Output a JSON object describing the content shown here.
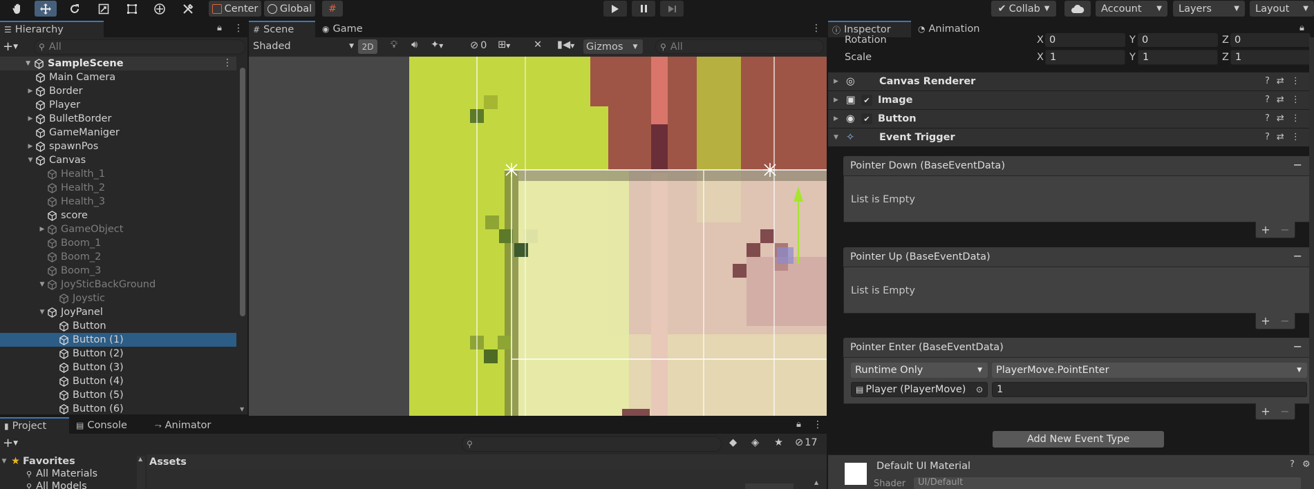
{
  "toolbar": {
    "center_label": "Center",
    "global_label": "Global",
    "collab_label": "Collab",
    "account_label": "Account",
    "layers_label": "Layers",
    "layout_label": "Layout"
  },
  "hierarchy": {
    "tab_label": "Hierarchy",
    "search_placeholder": "All",
    "scene_name": "SampleScene",
    "items": [
      {
        "label": "Main Camera",
        "depth": 1,
        "arrow": false,
        "dim": false
      },
      {
        "label": "Border",
        "depth": 1,
        "arrow": true,
        "dim": false
      },
      {
        "label": "Player",
        "depth": 1,
        "arrow": false,
        "dim": false
      },
      {
        "label": "BulletBorder",
        "depth": 1,
        "arrow": true,
        "dim": false
      },
      {
        "label": "GameManiger",
        "depth": 1,
        "arrow": false,
        "dim": false
      },
      {
        "label": "spawnPos",
        "depth": 1,
        "arrow": true,
        "dim": false
      },
      {
        "label": "Canvas",
        "depth": 1,
        "arrow": "open",
        "dim": false
      },
      {
        "label": "Health_1",
        "depth": 2,
        "arrow": false,
        "dim": true
      },
      {
        "label": "Health_2",
        "depth": 2,
        "arrow": false,
        "dim": true
      },
      {
        "label": "Health_3",
        "depth": 2,
        "arrow": false,
        "dim": true
      },
      {
        "label": "score",
        "depth": 2,
        "arrow": false,
        "dim": false
      },
      {
        "label": "GameObject",
        "depth": 2,
        "arrow": true,
        "dim": true
      },
      {
        "label": "Boom_1",
        "depth": 2,
        "arrow": false,
        "dim": true
      },
      {
        "label": "Boom_2",
        "depth": 2,
        "arrow": false,
        "dim": true
      },
      {
        "label": "Boom_3",
        "depth": 2,
        "arrow": false,
        "dim": true
      },
      {
        "label": "JoySticBackGround",
        "depth": 2,
        "arrow": "open",
        "dim": true
      },
      {
        "label": "Joystic",
        "depth": 3,
        "arrow": false,
        "dim": true
      },
      {
        "label": "JoyPanel",
        "depth": 2,
        "arrow": "open",
        "dim": false
      },
      {
        "label": "Button",
        "depth": 3,
        "arrow": false,
        "dim": false
      },
      {
        "label": "Button (1)",
        "depth": 3,
        "arrow": false,
        "dim": false,
        "selected": true
      },
      {
        "label": "Button (2)",
        "depth": 3,
        "arrow": false,
        "dim": false
      },
      {
        "label": "Button (3)",
        "depth": 3,
        "arrow": false,
        "dim": false
      },
      {
        "label": "Button (4)",
        "depth": 3,
        "arrow": false,
        "dim": false
      },
      {
        "label": "Button (5)",
        "depth": 3,
        "arrow": false,
        "dim": false
      },
      {
        "label": "Button (6)",
        "depth": 3,
        "arrow": false,
        "dim": false
      }
    ]
  },
  "scene": {
    "tab_scene": "Scene",
    "tab_game": "Game",
    "shading_mode": "Shaded",
    "mode_2d": "2D",
    "hidden_count": "0",
    "gizmos_label": "Gizmos",
    "search_placeholder": "All"
  },
  "project": {
    "tab_project": "Project",
    "tab_console": "Console",
    "tab_animator": "Animator",
    "favorites_label": "Favorites",
    "fav_items": [
      "All Materials",
      "All Models"
    ],
    "assets_label": "Assets",
    "hidden_count": "17"
  },
  "inspector": {
    "tab_inspector": "Inspector",
    "tab_animation": "Animation",
    "rotation_label": "Rotation",
    "scale_label": "Scale",
    "rotation": {
      "x": "0",
      "y": "0",
      "z": "0"
    },
    "scale": {
      "x": "1",
      "y": "1",
      "z": "1"
    },
    "axis_x": "X",
    "axis_y": "Y",
    "axis_z": "Z",
    "components": [
      "Canvas Renderer",
      "Image",
      "Button",
      "Event Trigger"
    ],
    "events": [
      {
        "header": "Pointer Down (BaseEventData)",
        "empty_text": "List is Empty"
      },
      {
        "header": "Pointer Up (BaseEventData)",
        "empty_text": "List is Empty"
      },
      {
        "header": "Pointer Enter (BaseEventData)",
        "runtime": "Runtime Only",
        "function": "PlayerMove.PointEnter",
        "object": "Player (PlayerMove)",
        "value": "1"
      }
    ],
    "add_event_label": "Add New Event Type",
    "material_name": "Default UI Material",
    "shader_label": "Shader",
    "shader_value": "UI/Default"
  }
}
